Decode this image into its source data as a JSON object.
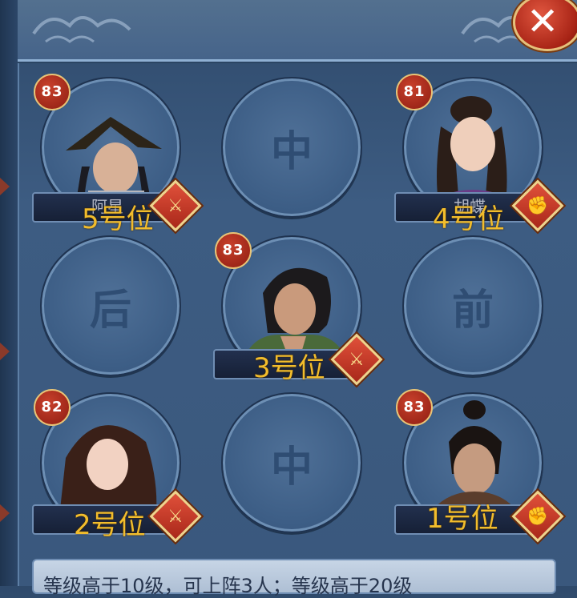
{
  "close": {
    "icon": "close-x-icon",
    "glyph": "✕"
  },
  "empty_slots": {
    "top_center": "中",
    "mid_left": "后",
    "mid_right": "前",
    "bottom_center": "中"
  },
  "heroes": [
    {
      "level": "83",
      "name": "阿星",
      "position": "5号位",
      "class_icon": "sword-icon",
      "glyph": "⚔"
    },
    {
      "level": "81",
      "name": "胡蝶",
      "position": "4号位",
      "class_icon": "fist-icon",
      "glyph": "✊"
    },
    {
      "level": "83",
      "name": "",
      "position": "3号位",
      "class_icon": "crossed-swords-icon",
      "glyph": "⚔"
    },
    {
      "level": "82",
      "name": "",
      "position": "2号位",
      "class_icon": "sword-icon",
      "glyph": "⚔"
    },
    {
      "level": "83",
      "name": "",
      "position": "1号位",
      "class_icon": "fist-icon",
      "glyph": "✊"
    }
  ],
  "footer": {
    "text": "等级高于10级，可上阵3人；等级高于20级"
  },
  "colors": {
    "accent_gold": "#f2bd2c",
    "badge_red": "#c8402b",
    "panel_blue": "#3d5e86"
  }
}
